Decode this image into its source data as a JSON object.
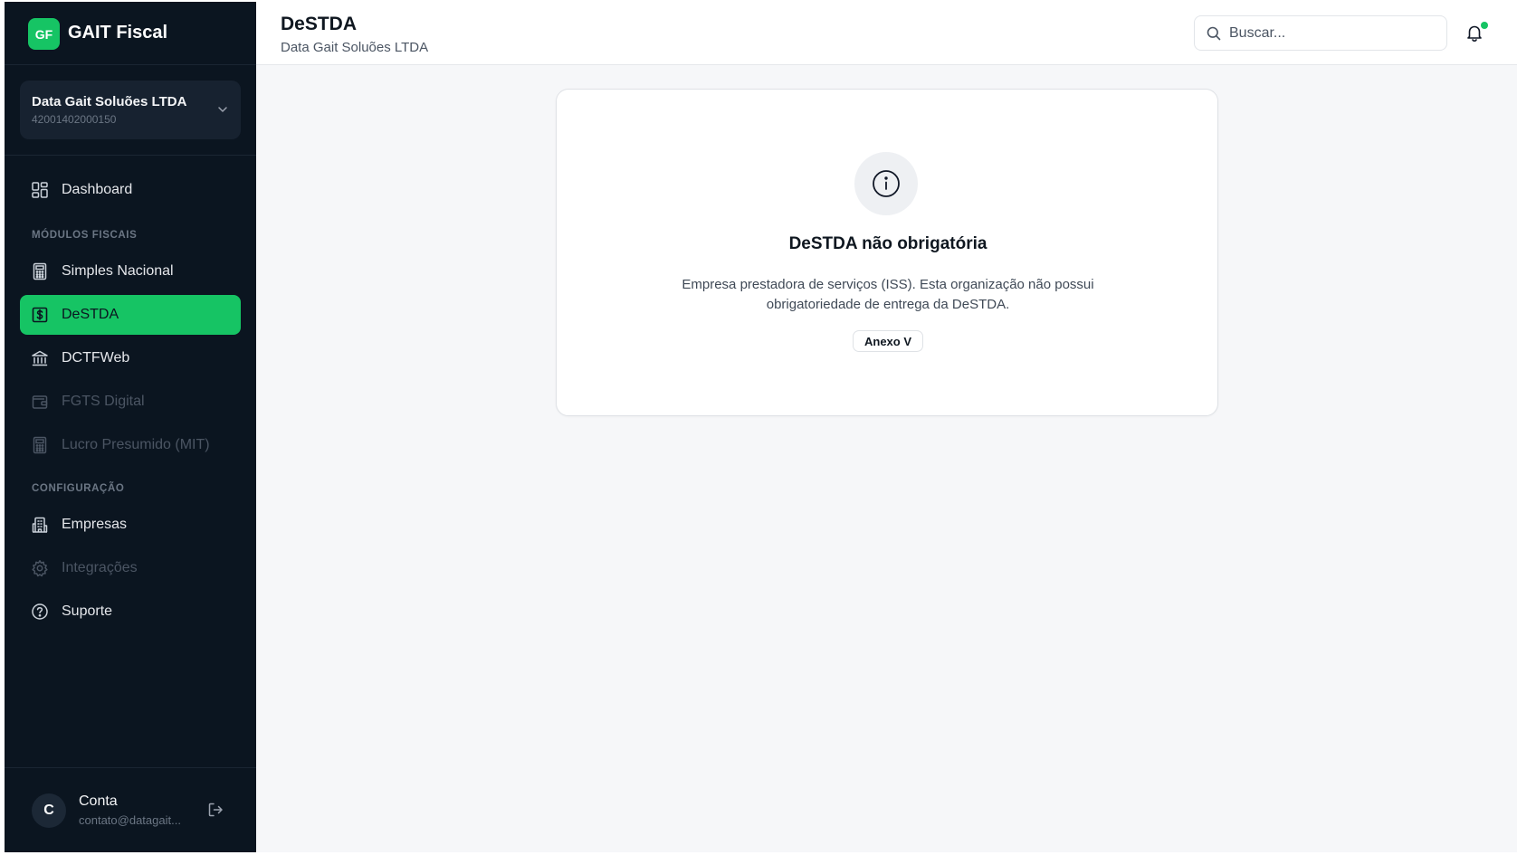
{
  "brand": {
    "logo_text": "GF",
    "name": "GAIT Fiscal"
  },
  "organization": {
    "name": "Data Gait Soluões LTDA",
    "cnpj": "42001402000150"
  },
  "sidebar": {
    "items": [
      {
        "label": "Dashboard",
        "icon": "dashboard-icon"
      },
      {
        "label": "Simples Nacional",
        "icon": "calculator-icon"
      },
      {
        "label": "DeSTDA",
        "icon": "dollar-receipt-icon",
        "active": true
      },
      {
        "label": "DCTFWeb",
        "icon": "bank-icon"
      },
      {
        "label": "FGTS Digital",
        "icon": "wallet-icon",
        "disabled": true
      },
      {
        "label": "Lucro Presumido (MIT)",
        "icon": "calculator-icon",
        "disabled": true
      },
      {
        "label": "Empresas",
        "icon": "building-icon"
      },
      {
        "label": "Integrações",
        "icon": "gear-icon",
        "disabled": true
      },
      {
        "label": "Suporte",
        "icon": "help-circle-icon"
      }
    ],
    "sections": {
      "fiscal": "MÓDULOS FISCAIS",
      "config": "CONFIGURAÇÃO"
    }
  },
  "account": {
    "initial": "C",
    "name": "Conta",
    "email": "contato@datagait..."
  },
  "header": {
    "title": "DeSTDA",
    "subtitle": "Data Gait Soluões LTDA"
  },
  "search": {
    "placeholder": "Buscar..."
  },
  "notice": {
    "title": "DeSTDA não obrigatória",
    "description": "Empresa prestadora de serviços (ISS). Esta organização não possui obrigatoriedade de entrega da DeSTDA.",
    "badge": "Anexo V"
  },
  "colors": {
    "sidebar_bg": "#0b1520",
    "accent": "#16c464",
    "main_bg": "#f6f7f9"
  }
}
